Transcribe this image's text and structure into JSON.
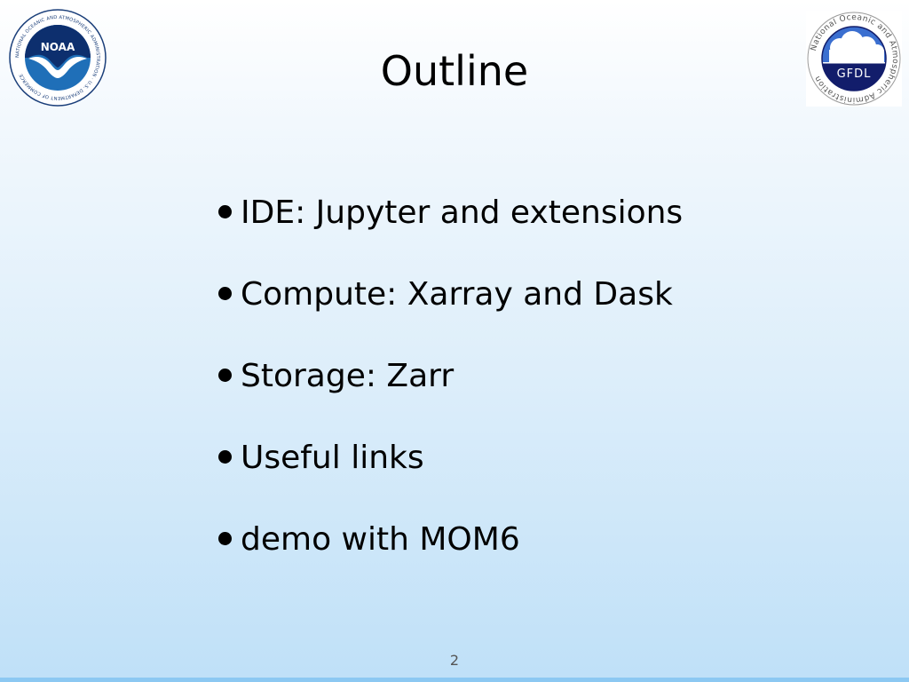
{
  "slide": {
    "title": "Outline",
    "page_number": "2",
    "bullets": [
      {
        "text": "IDE: Jupyter and extensions"
      },
      {
        "text": "Compute: Xarray and Dask"
      },
      {
        "text": "Storage: Zarr"
      },
      {
        "text": "Useful links"
      },
      {
        "text": "demo with MOM6"
      }
    ]
  },
  "logos": {
    "noaa": {
      "icon": "noaa-logo-icon",
      "wordmark": "NOAA",
      "ring_text": "NATIONAL OCEANIC AND ATMOSPHERIC ADMINISTRATION · U.S. DEPARTMENT OF COMMERCE"
    },
    "gfdl": {
      "icon": "gfdl-logo-icon",
      "wordmark": "GFDL",
      "ring_text": "National Oceanic and Atmospheric Administration"
    }
  },
  "colors": {
    "background_top": "#ffffff",
    "background_bottom": "#bfe0f8",
    "noaa_blue": "#1f6fb8",
    "noaa_navy": "#0d2f6e",
    "gfdl_navy": "#121d6b"
  }
}
